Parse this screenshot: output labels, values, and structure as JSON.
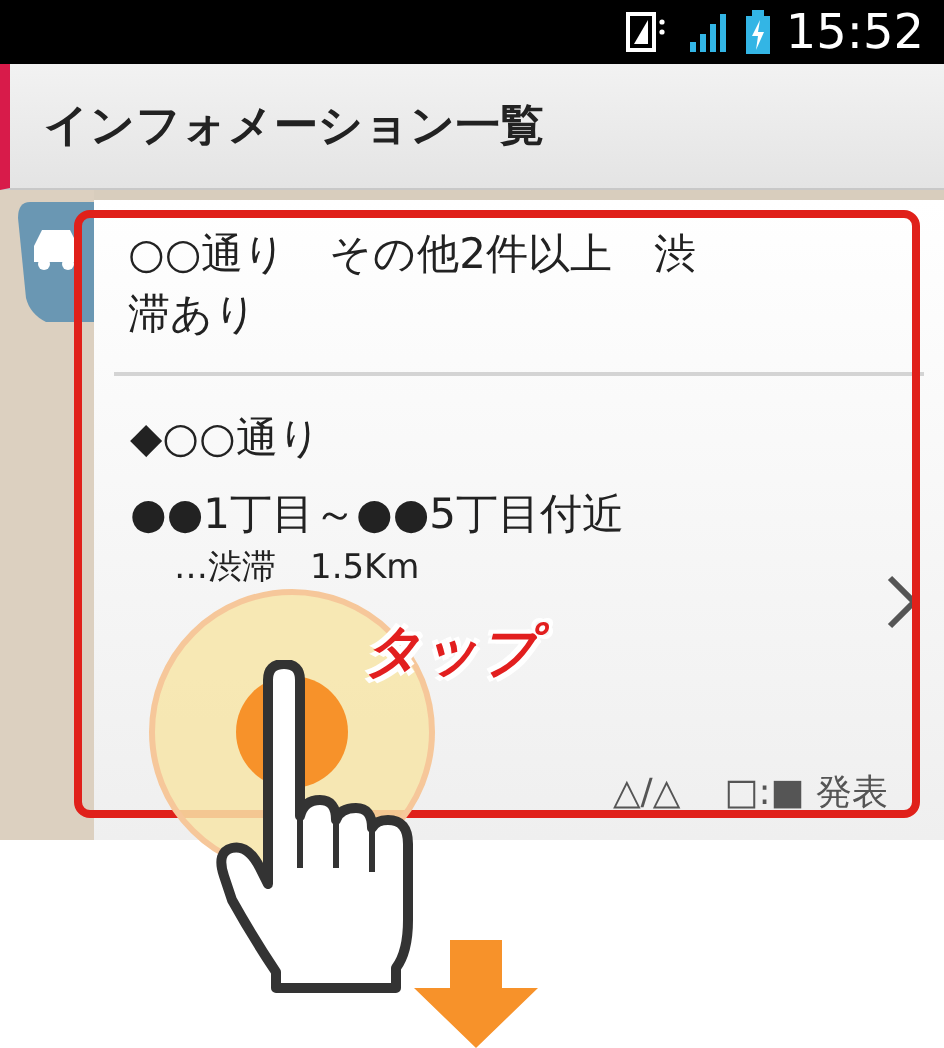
{
  "status_bar": {
    "time": "15:52"
  },
  "header": {
    "title": "インフォメーション一覧"
  },
  "card": {
    "headline": "○○通り　その他2件以上　渋滞あり",
    "road": "◆○○通り",
    "section": "●●1丁目～●●5丁目付近",
    "detail": "…渋滞　1.5Km",
    "date": "△/△",
    "announce": "□:■ 発表"
  },
  "overlay": {
    "tap_label": "タップ"
  }
}
